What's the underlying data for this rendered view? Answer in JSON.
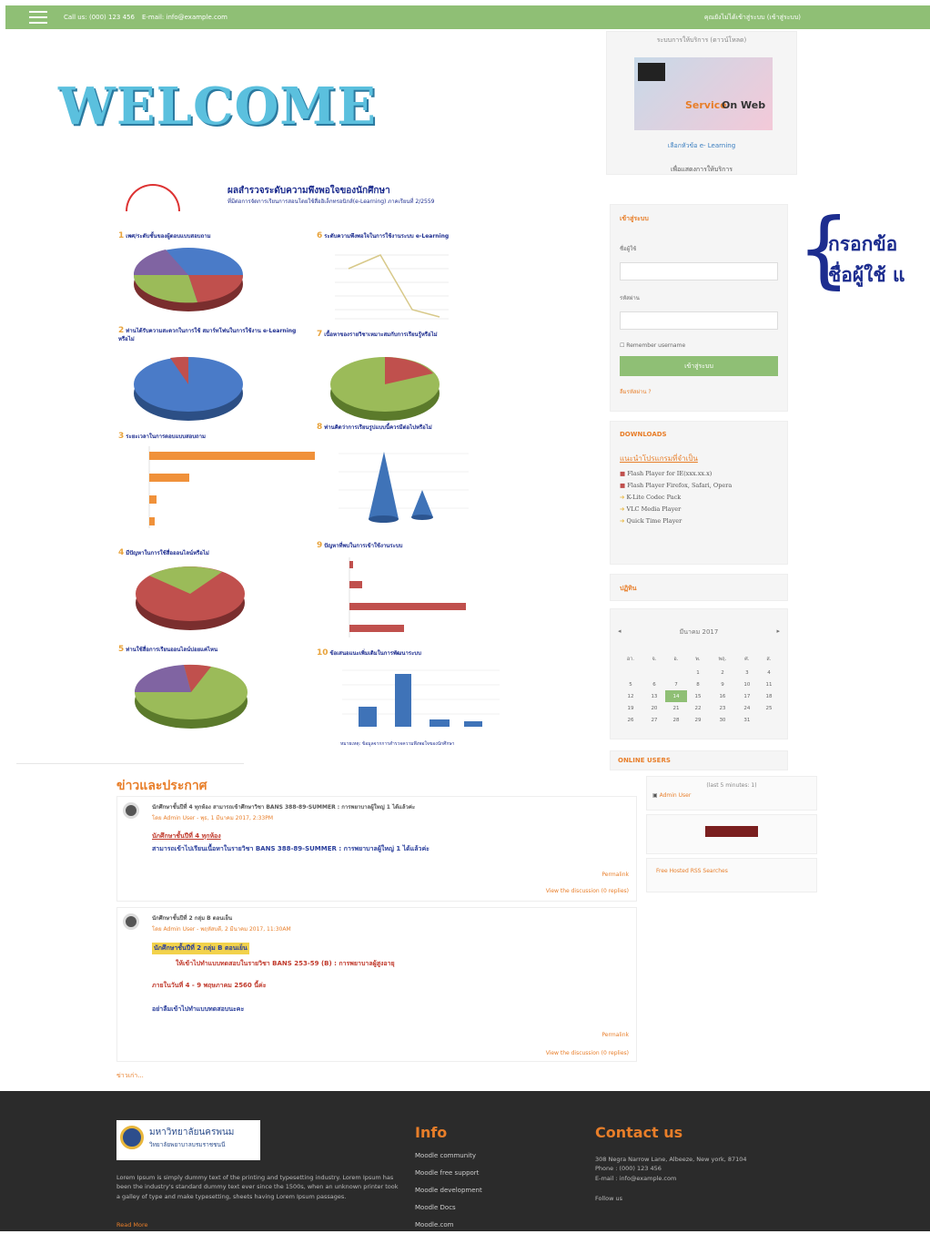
{
  "topbar": {
    "phone": "Call us: (000) 123 456",
    "email": "E-mail: info@example.com",
    "right_text": "คุณยังไม่ได้เข้าสู่ระบบ (เข้าสู่ระบบ)"
  },
  "welcome": "WELCOME",
  "poster": {
    "title": "ผลสำรวจระดับความพึงพอใจของนักศึกษา",
    "subtitle": "ที่มีต่อการจัดการเรียนการสอนโดยใช้สื่ออิเล็กทรอนิกส์(e-Learning) ภาคเรียนที่ 2/2559",
    "charts": [
      {
        "no": "1",
        "label": "เพศ/ระดับชั้นของผู้ตอบแบบสอบถาม"
      },
      {
        "no": "2",
        "label": "ท่านได้รับความสะดวกในการใช้ สมาร์ทโฟนในการใช้งาน e-Learning หรือไม่"
      },
      {
        "no": "3",
        "label": "ระยะเวลาในการตอบแบบสอบถาม"
      },
      {
        "no": "4",
        "label": "มีปัญหาในการใช้สื่อออนไลน์หรือไม่"
      },
      {
        "no": "5",
        "label": "ท่านใช้สื่อการเรียนออนไลน์บ่อยแค่ไหน"
      },
      {
        "no": "6",
        "label": "ระดับความพึงพอใจในการใช้งานระบบ e-Learning"
      },
      {
        "no": "7",
        "label": "เนื้อหาของรายวิชาเหมาะสมกับการเรียนรู้หรือไม่"
      },
      {
        "no": "8",
        "label": "ท่านคิดว่าการเรียนรูปแบบนี้ควรมีต่อไปหรือไม่"
      },
      {
        "no": "9",
        "label": "ปัญหาที่พบในการเข้าใช้งานระบบ"
      },
      {
        "no": "10",
        "label": "ข้อเสนอแนะเพิ่มเติมในการพัฒนาระบบ"
      }
    ],
    "footnote": "หมายเหตุ: ข้อมูลจากการสำรวจความพึงพอใจของนักศึกษา"
  },
  "sidebar": {
    "service_title": "ระบบการให้บริการ (ดาวน์โหลด)",
    "service_image_text_1": "Service",
    "service_image_text_2": "On Web",
    "service_link1": "เลือกหัวข้อ e- Learning",
    "service_link2": "เพื่อแสดงการให้บริการ",
    "login_title": "เข้าสู่ระบบ",
    "username_label": "ชื่อผู้ใช้",
    "password_label": "รหัสผ่าน",
    "remember": "Remember username",
    "login_button": "เข้าสู่ระบบ",
    "forgot": "ลืมรหัสผ่าน ?",
    "downloads_title": "DOWNLOADS",
    "downloads_sub": "แนะนำโปรแกรมที่จำเป็น",
    "downloads": [
      "Flash Player for IE(xxx.xx.x)",
      "Flash Player Firefox, Safari, Opera",
      "K-Lite Codec Pack",
      "VLC Media Player",
      "Quick Time Player"
    ],
    "calendar_title": "ปฏิทิน",
    "calendar_month": "มีนาคม 2017",
    "calendar_days": [
      "อา.",
      "จ.",
      "อ.",
      "พ.",
      "พฤ.",
      "ศ.",
      "ส."
    ],
    "calendar_weeks": [
      [
        "",
        "",
        "",
        "1",
        "2",
        "3",
        "4"
      ],
      [
        "5",
        "6",
        "7",
        "8",
        "9",
        "10",
        "11"
      ],
      [
        "12",
        "13",
        "14",
        "15",
        "16",
        "17",
        "18"
      ],
      [
        "19",
        "20",
        "21",
        "22",
        "23",
        "24",
        "25"
      ],
      [
        "26",
        "27",
        "28",
        "29",
        "30",
        "31",
        ""
      ]
    ],
    "calendar_today": "14",
    "online_title": "ONLINE USERS",
    "online_count": "(last 5 minutes: 1)",
    "online_user": "Admin User",
    "feed_link": "Free Hosted RSS Searches"
  },
  "note": {
    "line1": "กรอกข้อ",
    "line2": "ชื่อผู้ใช้ แ"
  },
  "news": {
    "title": "ข่าวและประกาศ",
    "posts": [
      {
        "subject": "นักศึกษาชั้นปีที่ 4 ทุกห้อง สามารถเข้าศึกษาวิชา BANS 388-89-SUMMER : การพยาบาลผู้ใหญ่ 1 ได้แล้วค่ะ",
        "byline": "โดย Admin User - พุธ, 1 มีนาคม 2017, 2:33PM",
        "highlight": "นักศึกษาชั้นปีที่ 4 ทุกห้อง",
        "body": "สามารถเข้าไปเรียนเนื้อหาในรายวิชา BANS 388-89-SUMMER : การพยาบาลผู้ใหญ่ 1 ได้แล้วค่ะ",
        "permalink": "Permalink",
        "discuss": "View the discussion (0 replies)"
      },
      {
        "subject": "นักศึกษาชั้นปีที่ 2 กลุ่ม B ตอนเย็น",
        "byline": "โดย Admin User - พฤหัสบดี, 2 มีนาคม 2017, 11:30AM",
        "highlight": "นักศึกษาชั้นปีที่ 2 กลุ่ม B ตอนเย็น",
        "body": "ให้เข้าไปทำแบบทดสอบในรายวิชา BANS 253-59 (B) : การพยาบาลผู้สูงอายุ",
        "body2": "ภายในวันที่ 4 - 9 พฤษภาคม 2560 นี้ค่ะ",
        "body3": "อย่าลืมเข้าไปทำแบบทดสอบนะคะ",
        "permalink": "Permalink",
        "discuss": "View the discussion (0 replies)"
      }
    ],
    "older": "ข่าวเก่า..."
  },
  "footer": {
    "logo_text_1": "มหาวิทยาลัยนครพนม",
    "logo_text_2": "วิทยาลัยพยาบาลบรมราชชนนี",
    "about": "Lorem Ipsum is simply dummy text of the printing and typesetting industry. Lorem Ipsum has been the industry's standard dummy text ever since the 1500s, when an unknown printer took a galley of type and make typesetting, sheets having Lorem Ipsum passages.",
    "read_more": "Read More",
    "info_title": "Info",
    "info_links": [
      "Moodle community",
      "Moodle free support",
      "Moodle development",
      "Moodle Docs",
      "Moodle.com"
    ],
    "contact_title": "Contact us",
    "address": "308 Negra Narrow Lane, Albeeze, New york, 87104",
    "phone": "Phone : (000) 123 456",
    "email": "E-mail : info@example.com",
    "follow": "Follow us"
  }
}
